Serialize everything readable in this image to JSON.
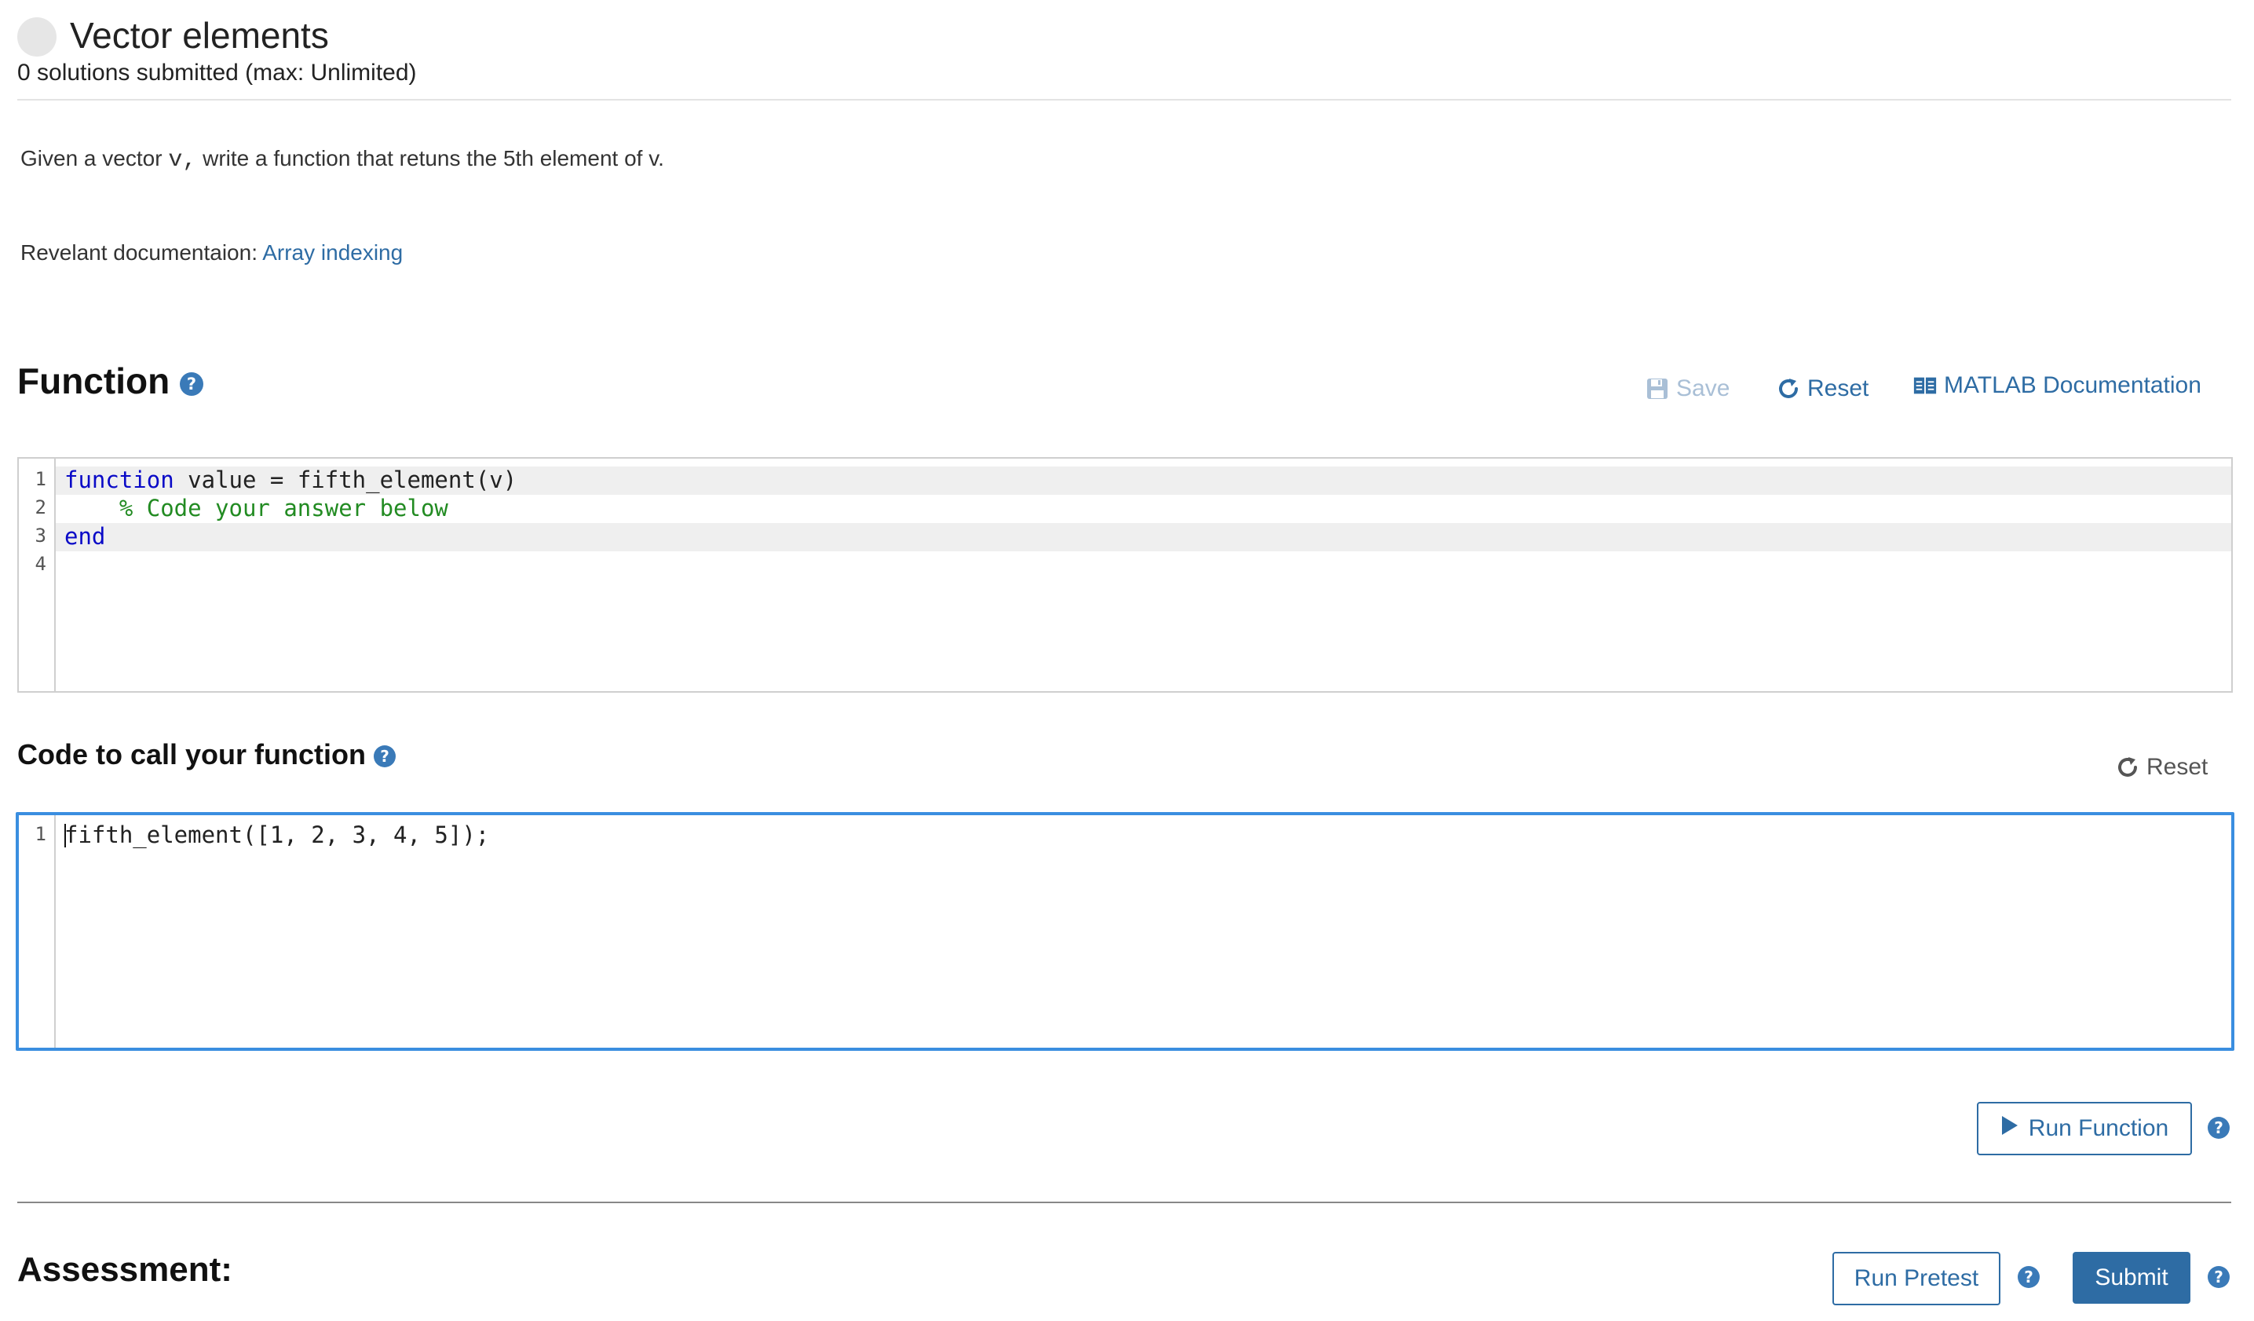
{
  "header": {
    "title": "Vector elements",
    "subtitle": "0 solutions submitted (max: Unlimited)"
  },
  "description": {
    "pre": "Given a vector ",
    "var": "v,",
    "post": " write a function that retuns the 5th element of v."
  },
  "documentation": {
    "label": "Revelant documentaion: ",
    "link_text": "Array indexing"
  },
  "function_section": {
    "heading": "Function",
    "help": "?",
    "save_label": "Save",
    "reset_label": "Reset",
    "docs_label": "MATLAB Documentation",
    "line_numbers": [
      "1",
      "2",
      "3",
      "4"
    ],
    "code": {
      "line1_kw": "function",
      "line1_rest": " value = fifth_element(v)",
      "line2_comment": "    % Code your answer below",
      "line3_kw": "end"
    }
  },
  "call_section": {
    "heading": "Code to call your function",
    "help": "?",
    "reset_label": "Reset",
    "line_numbers": [
      "1"
    ],
    "code": "fifth_element([1, 2, 3, 4, 5]);"
  },
  "actions": {
    "run_function_label": "Run Function",
    "run_pretest_label": "Run Pretest",
    "submit_label": "Submit",
    "help": "?"
  },
  "assessment": {
    "heading": "Assessment:"
  },
  "colors": {
    "accent": "#2e6ca4",
    "focus_border": "#3a8ee0",
    "keyword": "#0a0ac7",
    "comment": "#228b22"
  },
  "icons": {
    "save": "floppy-disk-icon",
    "reset": "refresh-icon",
    "docs": "book-icon",
    "run": "play-icon",
    "help": "question-circle-icon"
  }
}
